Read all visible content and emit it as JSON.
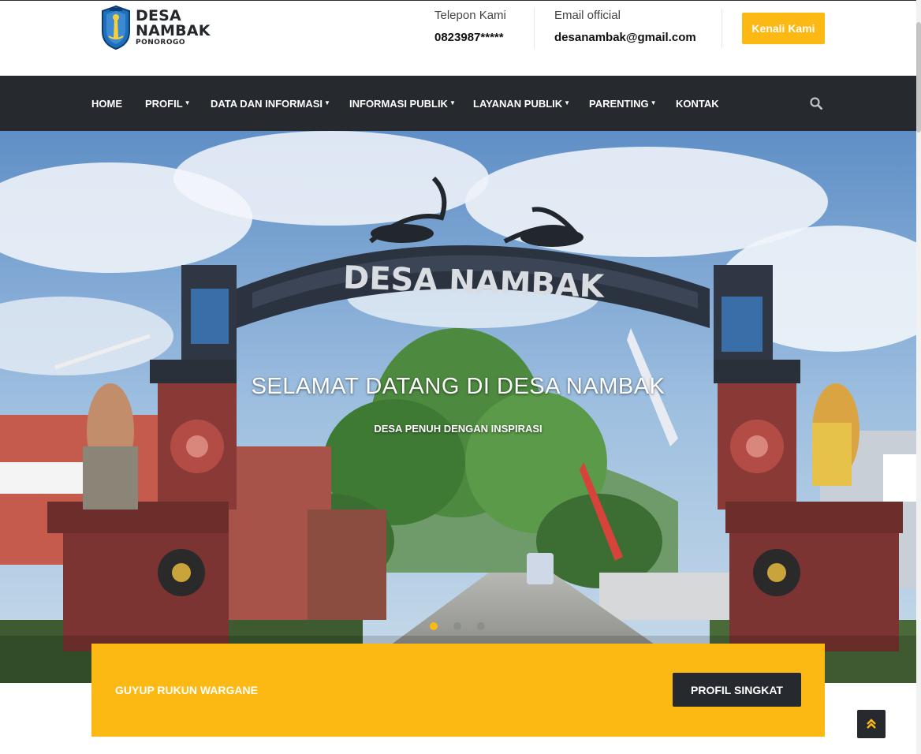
{
  "logo": {
    "line1": "DESA",
    "line2": "NAMBAK",
    "line3": "PONOROGO"
  },
  "contact": {
    "phone_label": "Telepon Kami",
    "phone_value": "0823987*****",
    "email_label": "Email official",
    "email_value": "desanambak@gmail.com"
  },
  "header_button": "Kenali Kami",
  "nav": {
    "items": [
      {
        "label": "HOME",
        "dropdown": false
      },
      {
        "label": "PROFIL",
        "dropdown": true
      },
      {
        "label": "DATA DAN INFORMASI",
        "dropdown": true
      },
      {
        "label": "INFORMASI PUBLIK",
        "dropdown": true
      },
      {
        "label": "LAYANAN PUBLIK",
        "dropdown": true
      },
      {
        "label": "PARENTING",
        "dropdown": true
      },
      {
        "label": "KONTAK",
        "dropdown": false
      }
    ],
    "search_icon": "search-icon"
  },
  "hero": {
    "title": "SELAMAT DATANG DI DESA NAMBAK",
    "subtitle": "DESA PENUH DENGAN INSPIRASI",
    "gate_text": "DESA NAMBAK",
    "slides": 3,
    "active_slide": 1
  },
  "banner": {
    "text": "GUYUP RUKUN WARGANE",
    "button": "PROFIL SINGKAT"
  },
  "colors": {
    "accent": "#fdb913",
    "dark": "#262a2e"
  }
}
